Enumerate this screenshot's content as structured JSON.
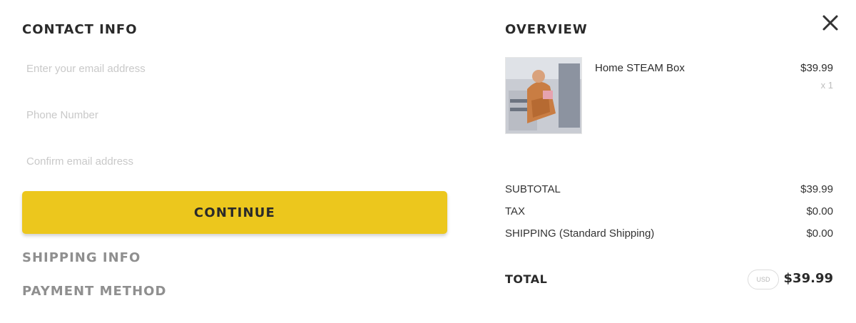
{
  "contact": {
    "title": "CONTACT INFO",
    "email_placeholder": "Enter your email address",
    "phone_placeholder": "Phone Number",
    "confirm_placeholder": "Confirm email address",
    "continue_label": "CONTINUE"
  },
  "shipping": {
    "title": "SHIPPING INFO"
  },
  "payment": {
    "title": "PAYMENT METHOD"
  },
  "overview": {
    "title": "OVERVIEW",
    "item": {
      "name": "Home STEAM Box",
      "price": "$39.99",
      "qty": "x 1"
    },
    "subtotal_label": "SUBTOTAL",
    "subtotal_value": "$39.99",
    "tax_label": "TAX",
    "tax_value": "$0.00",
    "shipping_label": "SHIPPING",
    "shipping_method": "(Standard Shipping)",
    "shipping_value": "$0.00",
    "total_label": "TOTAL",
    "currency": "USD",
    "total_value": "$39.99"
  },
  "colors": {
    "accent": "#ecc71d",
    "text": "#2a2a2a",
    "muted": "#8f8f8f"
  },
  "icons": {
    "close": "close-icon"
  }
}
